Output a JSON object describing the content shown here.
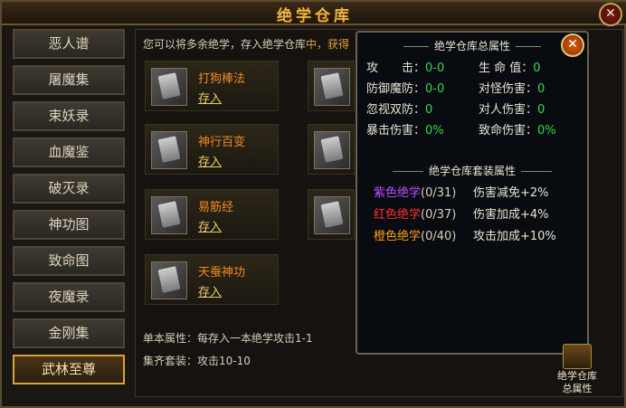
{
  "title": "绝学仓库",
  "close_icon": "close-icon",
  "sidebar": {
    "items": [
      {
        "label": "恶人谱"
      },
      {
        "label": "屠魔集"
      },
      {
        "label": "束妖录"
      },
      {
        "label": "血魔鉴"
      },
      {
        "label": "破灭录"
      },
      {
        "label": "神功图"
      },
      {
        "label": "致命图"
      },
      {
        "label": "夜魔录"
      },
      {
        "label": "金刚集"
      },
      {
        "label": "武林至尊"
      }
    ],
    "active_index": 9
  },
  "main": {
    "intro_text": "您可以将多余绝学，存入绝学仓库",
    "intro_highlight": "中，获得",
    "store_label": "存入",
    "slots": [
      {
        "name": "打狗棒法"
      },
      {
        "name": "神行百变"
      },
      {
        "name": "易筋经"
      },
      {
        "name": "天蚕神功"
      }
    ],
    "basic_attr": "单本属性：每存入一本绝学攻击1-1",
    "suit_attr": "集齐套装：攻击10-10"
  },
  "overlay": {
    "heading": "绝学仓库总属性",
    "stats": [
      {
        "label": "攻　　击：",
        "value": "0-0"
      },
      {
        "label": "生 命 值：",
        "value": "0"
      },
      {
        "label": "防御魔防：",
        "value": "0-0"
      },
      {
        "label": "对怪伤害：",
        "value": "0"
      },
      {
        "label": "忽视双防：",
        "value": "0"
      },
      {
        "label": "对人伤害：",
        "value": "0"
      },
      {
        "label": "暴击伤害：",
        "value": "0%"
      },
      {
        "label": "致命伤害：",
        "value": "0%"
      }
    ],
    "set_heading": "绝学仓库套装属性",
    "sets": [
      {
        "name": "紫色绝学",
        "count": "(0/31)",
        "effect": "伤害减免+2%",
        "color": "#c04cff"
      },
      {
        "name": "红色绝学",
        "count": "(0/37)",
        "effect": "伤害加成+4%",
        "color": "#ff3030"
      },
      {
        "name": "橙色绝学",
        "count": "(0/40)",
        "effect": "攻击加成+10%",
        "color": "#ff9a1a"
      }
    ]
  },
  "total_button": {
    "line1": "绝学仓库",
    "line2": "总属性"
  }
}
